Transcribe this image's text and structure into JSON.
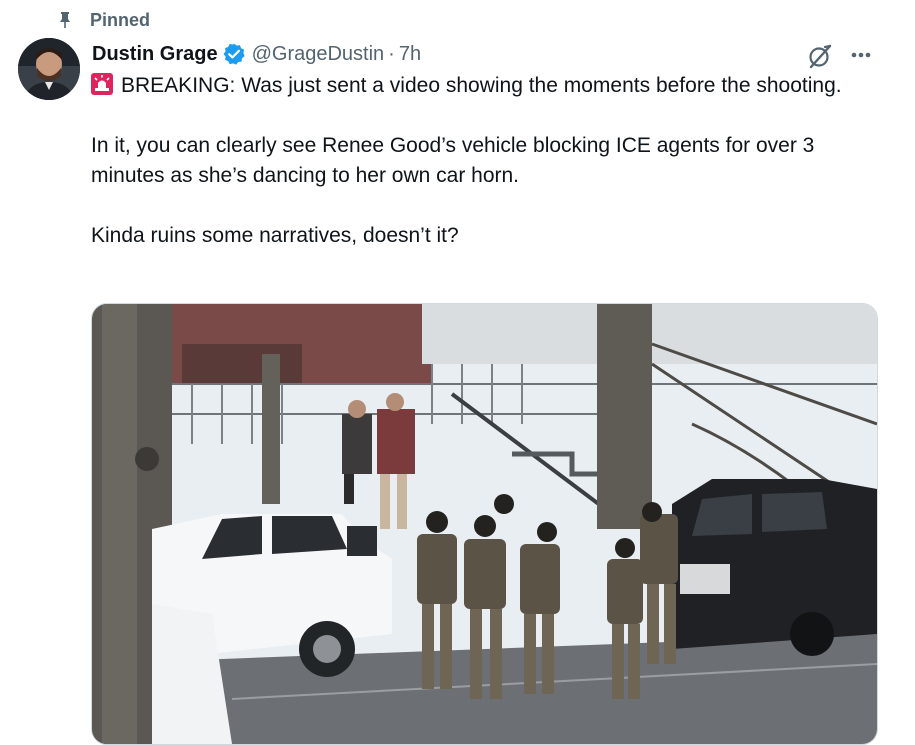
{
  "pinned": {
    "label": "Pinned",
    "icon": "pin-icon"
  },
  "tweet": {
    "author": {
      "name": "Dustin Grage",
      "handle": "@GrageDustin",
      "verified": true
    },
    "separator": "·",
    "time": "7h",
    "text": {
      "p1_icon": "siren-emoji-icon",
      "p1": "BREAKING: Was just sent a video showing the moments before the shooting.",
      "p2": "In it, you can clearly see Renee Good’s vehicle blocking ICE agents for over 3 minutes as she’s dancing to her own car horn.",
      "p3": "Kinda ruins some narratives, doesn’t it?"
    },
    "actions": {
      "grok_icon": "grok-icon",
      "more_icon": "more-icon"
    }
  },
  "colors": {
    "text": "#0f1419",
    "secondary": "#536471",
    "verified_blue": "#1d9bf0",
    "siren_red": "#e0245e"
  }
}
